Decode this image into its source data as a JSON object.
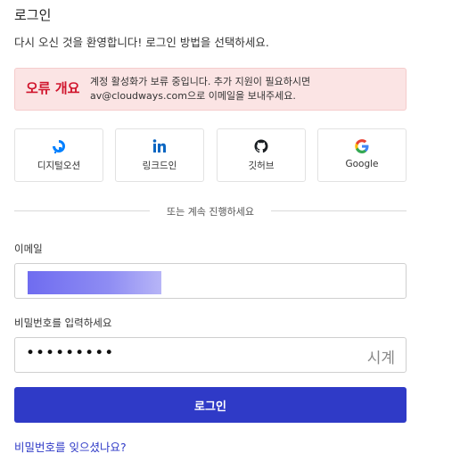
{
  "header": {
    "title": "로그인",
    "subtitle": "다시 오신 것을 환영합니다! 로그인 방법을 선택하세요."
  },
  "alert": {
    "label": "오류 개요",
    "line1": "계정 활성화가 보류 중입니다. 추가 지원이 필요하시면",
    "line2": "av@cloudways.com으로 이메일을 보내주세요."
  },
  "social": [
    {
      "label": "디지털오션",
      "icon": "digitalocean-icon",
      "color": "#0080ff"
    },
    {
      "label": "링크드인",
      "icon": "linkedin-icon",
      "color": "#0a66c2"
    },
    {
      "label": "깃허브",
      "icon": "github-icon",
      "color": "#1b1f23"
    },
    {
      "label": "Google",
      "icon": "google-icon",
      "color": "#4285f4"
    }
  ],
  "divider": {
    "text": "또는 계속 진행하세요"
  },
  "email": {
    "label": "이메일",
    "value": ""
  },
  "password": {
    "label": "비밀번호를 입력하세요",
    "value": "•••••••••",
    "toggle_label": "시계"
  },
  "login_button": {
    "label": "로그인",
    "color": "#2f3ac7"
  },
  "forgot_link": {
    "label": "비밀번호를 잊으셨나요?"
  },
  "colors": {
    "error": "#d0142c",
    "alert_bg": "#fbe4e4",
    "link": "#2f3ac7"
  }
}
